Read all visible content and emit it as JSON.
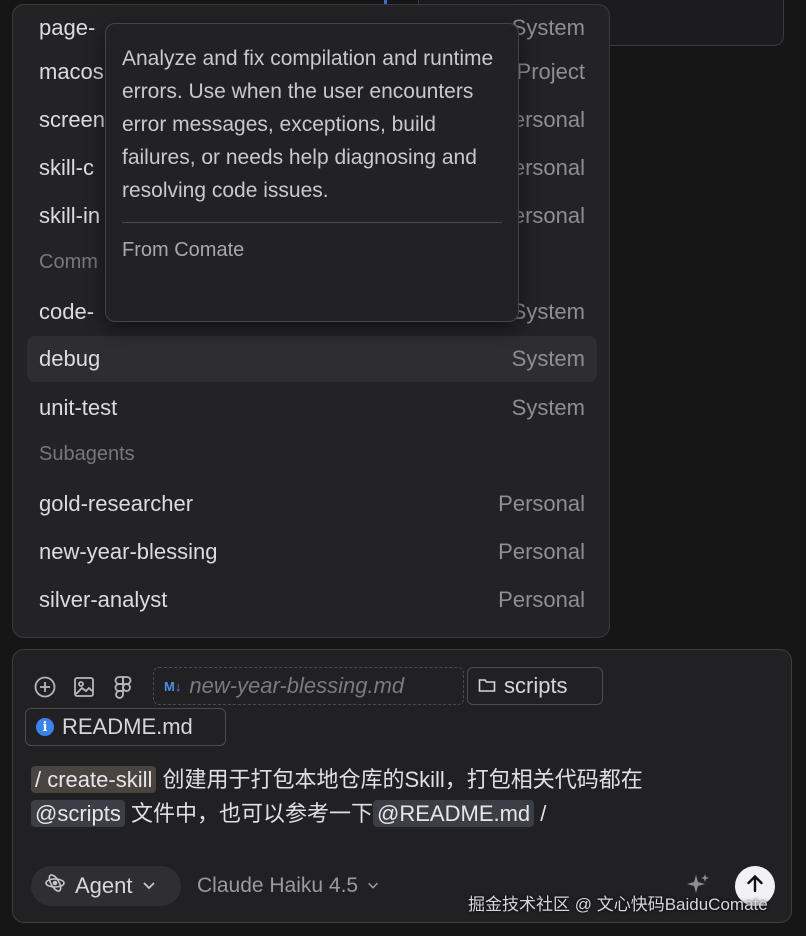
{
  "menu": {
    "rows": [
      {
        "label": "page-",
        "source": "System"
      },
      {
        "label": "macos",
        "source": "Project"
      },
      {
        "label": "screen",
        "source": "Personal"
      },
      {
        "label": "skill-c",
        "source": "Personal"
      },
      {
        "label": "skill-in",
        "source": "Personal"
      }
    ],
    "section_commands": "Comm",
    "command_rows": [
      {
        "label": "code-",
        "source": "System"
      },
      {
        "label": "debug",
        "source": "System"
      },
      {
        "label": "unit-test",
        "source": "System"
      }
    ],
    "section_subagents": "Subagents",
    "subagent_rows": [
      {
        "label": "gold-researcher",
        "source": "Personal"
      },
      {
        "label": "new-year-blessing",
        "source": "Personal"
      },
      {
        "label": "silver-analyst",
        "source": "Personal"
      }
    ]
  },
  "tooltip": {
    "description": "Analyze and fix compilation and runtime errors. Use when the user encounters error messages, exceptions, build failures, or needs help diagnosing and resolving code issues.",
    "from": "From Comate"
  },
  "input": {
    "chips": {
      "markdown_file": "new-year-blessing.md",
      "folder": "scripts",
      "readme": "README.md"
    },
    "message": {
      "command": "/ create-skill",
      "text1": " 创建用于打包本地仓库的Skill，打包相关代码都在",
      "ref1": "@scripts",
      "text2": " 文件中，也可以参考一下",
      "ref2": "@README.md",
      "text3": " /"
    },
    "agent_label": "Agent",
    "model_label": "Claude Haiku 4.5"
  },
  "watermark": "掘金技术社区 @ 文心快码BaiduComate",
  "icons": [
    "add-circle-icon",
    "image-icon",
    "figma-icon",
    "markdown-icon",
    "folder-icon",
    "info-icon",
    "agent-icon",
    "chevron-down-icon",
    "sparkle-icon",
    "arrow-up-icon"
  ],
  "colors": {
    "accent_blue": "#3a82f0",
    "menu_bg": "#232325",
    "active_row": "#2e2e31"
  }
}
